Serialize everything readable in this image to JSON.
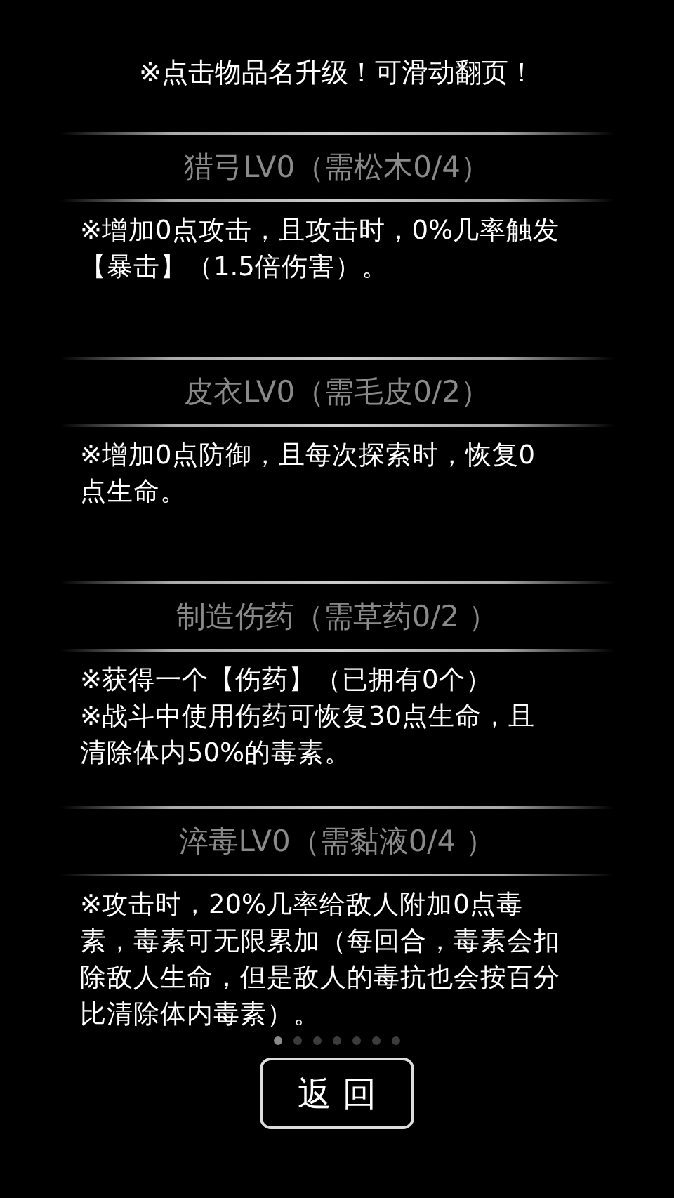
{
  "hint": "※点击物品名升级！可滑动翻页！",
  "items": [
    {
      "title": "猎弓LV0（需松木0/4）",
      "paragraphs": [
        "※增加0点攻击，且攻击时，0%几率触发【暴击】（1.5倍伤害）。"
      ]
    },
    {
      "title": "皮衣LV0（需毛皮0/2）",
      "paragraphs": [
        "※增加0点防御，且每次探索时，恢复0点生命。"
      ]
    },
    {
      "title": "制造伤药（需草药0/2 ）",
      "paragraphs": [
        "※获得一个【伤药】（已拥有0个）",
        "※战斗中使用伤药可恢复30点生命，且清除体内50%的毒素。"
      ]
    },
    {
      "title": "淬毒LV0（需黏液0/4 ）",
      "paragraphs": [
        "※攻击时，20%几率给敌人附加0点毒素，毒素可无限累加（每回合，毒素会扣除敌人生命，但是敌人的毒抗也会按百分比清除体内毒素）。"
      ]
    }
  ],
  "pages": [
    {
      "selected": true
    },
    {
      "selected": false
    },
    {
      "selected": false
    },
    {
      "selected": false
    },
    {
      "selected": false
    },
    {
      "selected": false
    },
    {
      "selected": false
    }
  ],
  "back_button": "返 回"
}
